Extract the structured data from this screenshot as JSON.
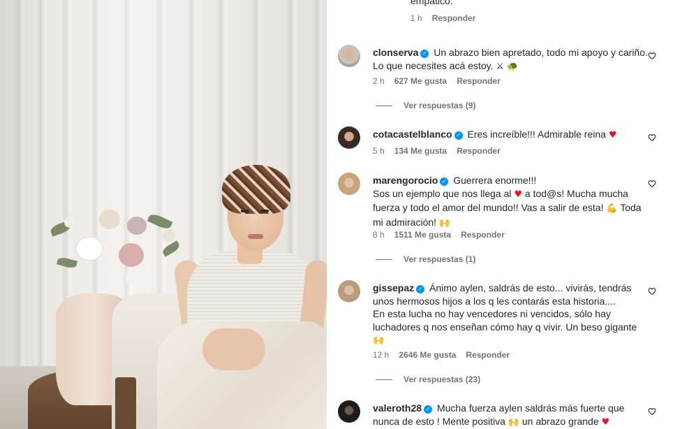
{
  "top_comment": {
    "text_tail": "empático.",
    "time": "1 h",
    "reply": "Responder"
  },
  "comments": [
    {
      "username": "clonserva",
      "text": "Un abrazo bien apretado, todo mi apoyo y cariño. Lo que necesites acá estoy.",
      "emoji": "⚔ 🐢",
      "time": "2 h",
      "likes": "627 Me gusta",
      "reply": "Responder",
      "view_replies": "Ver respuestas (9)"
    },
    {
      "username": "cotacastelblanco",
      "text": "Eres increíble!!! Admirable reina",
      "emoji": "♥",
      "time": "5 h",
      "likes": "134 Me gusta",
      "reply": "Responder"
    },
    {
      "username": "marengorocio",
      "text_1": "Guerrera enorme!!!",
      "text_2": "Sos un ejemplo que nos llega al",
      "emoji_heart": "♥",
      "text_3": "a tod@s! Mucha mucha fuerza y todo el amor del mundo!! Vas a salir de esta!",
      "emoji_strong": "💪",
      "text_4": "Toda mi admiración!",
      "emoji_pray": "🙌",
      "time": "8 h",
      "likes": "1511 Me gusta",
      "reply": "Responder",
      "view_replies": "Ver respuestas (1)"
    },
    {
      "username": "gissepaz",
      "text_1": "Ánimo aylen, saldrás de esto... vivirás, tendrás unos hermosos hijos a los q les contarás esta historia....",
      "text_2": "En esta lucha no hay vencedores ni vencidos, sólo hay luchadores q nos enseñan cómo hay q vivir. Un beso gigante",
      "emoji_pray": "🙌",
      "time": "12 h",
      "likes": "2646 Me gusta",
      "reply": "Responder",
      "view_replies": "Ver respuestas (23)"
    },
    {
      "username": "valeroth28",
      "text_1": "Mucha fuerza aylen saldrás más fuerte que nunca de esto ! Mente positiva",
      "emoji_pray": "🙌",
      "text_2": "un abrazo grande",
      "emoji_heart": "♥"
    }
  ],
  "icons": {
    "verified": "verified-badge-icon",
    "like": "heart-outline-icon"
  },
  "colors": {
    "verified_blue": "#0095f6",
    "heart_red": "#e0192a",
    "meta_gray": "#737373"
  }
}
